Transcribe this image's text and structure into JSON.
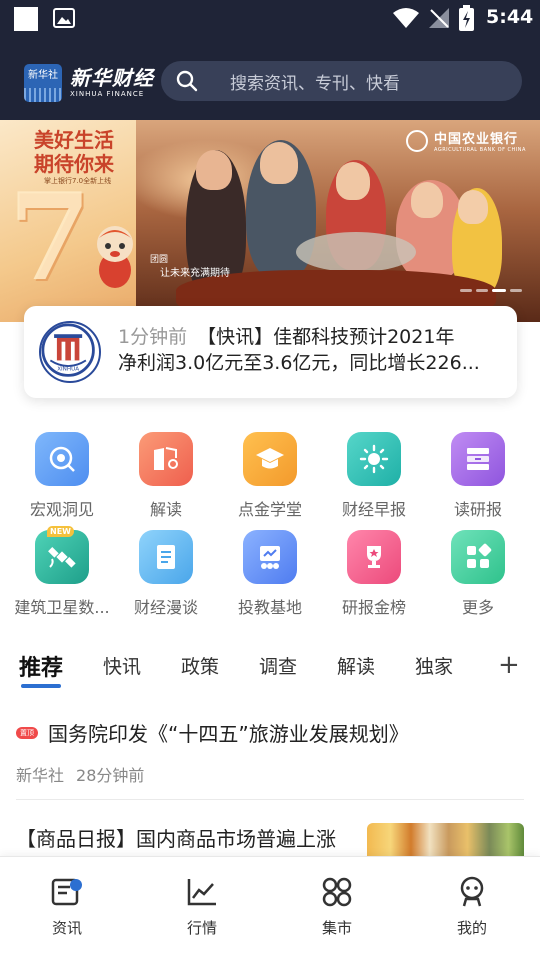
{
  "status_bar": {
    "time": "5:44"
  },
  "header": {
    "logo_cn": "新华财经",
    "logo_badge": "新华社",
    "logo_en": "XINHUA FINANCE",
    "search_placeholder": "搜索资讯、专刊、快看"
  },
  "banner": {
    "slogan_line1": "美好生活",
    "slogan_line2": "期待你来",
    "sub_text": "掌上银行7.0全新上线",
    "big_number": "7",
    "bank_name_cn": "中国农业银行",
    "bank_name_en": "AGRICULTURAL BANK OF CHINA",
    "caption1": "团圆",
    "caption2": "让未来充满期待"
  },
  "news_card": {
    "time": "1分钟前",
    "line1": "【快讯】佳都科技预计2021年",
    "line2": "净利润3.0亿元至3.6亿元，同比增长226...",
    "emblem_text": "XINHUA"
  },
  "grid": {
    "items": [
      {
        "label": "宏观洞见",
        "icon": "binoculars-icon",
        "color": "#5b9cf5"
      },
      {
        "label": "解读",
        "icon": "book-search-icon",
        "color": "#f47a5f"
      },
      {
        "label": "点金学堂",
        "icon": "graduation-cap-icon",
        "color": "#f7a93c"
      },
      {
        "label": "财经早报",
        "icon": "sun-icon",
        "color": "#34c3b8"
      },
      {
        "label": "读研报",
        "icon": "report-stack-icon",
        "color": "#a66be6"
      },
      {
        "label": "建筑卫星数...",
        "icon": "satellite-icon",
        "color": "#2fbfa8",
        "badge": "NEW"
      },
      {
        "label": "财经漫谈",
        "icon": "document-icon",
        "color": "#5fb4f0"
      },
      {
        "label": "投教基地",
        "icon": "classroom-icon",
        "color": "#5b8af5"
      },
      {
        "label": "研报金榜",
        "icon": "trophy-icon",
        "color": "#f25c8c"
      },
      {
        "label": "更多",
        "icon": "more-grid-icon",
        "color": "#3fcf9a"
      }
    ]
  },
  "tabs": {
    "items": [
      "推荐",
      "快讯",
      "政策",
      "调查",
      "解读",
      "独家"
    ],
    "active_index": 0,
    "add_label": "+"
  },
  "articles": [
    {
      "tag": "置顶",
      "title": "国务院印发《“十四五”旅游业发展规划》",
      "source": "新华社",
      "time": "28分钟前"
    },
    {
      "title": "【商品日报】国内商品市场普遍上涨"
    }
  ],
  "bottom_nav": {
    "items": [
      {
        "label": "资讯",
        "icon": "news-icon"
      },
      {
        "label": "行情",
        "icon": "chart-icon"
      },
      {
        "label": "集市",
        "icon": "market-icon"
      },
      {
        "label": "我的",
        "icon": "profile-icon"
      }
    ]
  }
}
